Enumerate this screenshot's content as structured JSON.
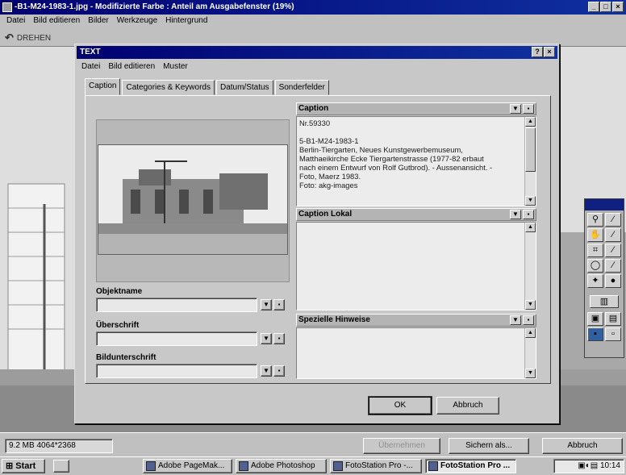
{
  "app": {
    "title": "-B1-M24-1983-1.jpg - Modifizierte Farbe : Anteil am Ausgabefenster (19%)",
    "menu": [
      "Datei",
      "Bild editieren",
      "Bilder",
      "Werkzeuge",
      "Hintergrund"
    ],
    "toolbar_rotate_label": "DREHEN"
  },
  "dialog": {
    "title": "TEXT",
    "menu": [
      "Datei",
      "Bild editieren",
      "Muster"
    ],
    "tabs": [
      "Caption",
      "Categories & Keywords",
      "Datum/Status",
      "Sonderfelder"
    ],
    "active_tab": "Caption",
    "fields": {
      "objektname_label": "Objektname",
      "ueberschrift_label": "Überschrift",
      "bildunterschrift_label": "Bildunterschrift"
    },
    "sections": {
      "caption_label": "Caption",
      "caption_text": "Nr.59330\n\n5-B1-M24-1983-1\nBerlin-Tiergarten, Neues Kunstgewerbemuseum,\nMatthaeikirche Ecke Tiergartenstrasse (1977-82 erbaut\nnach einem Entwurf von Rolf Gutbrod). - Aussenansicht. -\nFoto, Maerz 1983.\nFoto: akg-images",
      "caption_lokal_label": "Caption Lokal",
      "spezielle_hinweise_label": "Spezielle Hinweise"
    },
    "buttons": {
      "ok": "OK",
      "abbruch": "Abbruch"
    }
  },
  "status": {
    "file_info": "9.2 MB  4064*2368",
    "btn_uebernehmen": "Übernehmen",
    "btn_sichern": "Sichern als...",
    "btn_abbruch": "Abbruch"
  },
  "taskbar": {
    "start": "Start",
    "tasks": [
      "Adobe PageMak...",
      "Adobe Photoshop",
      "FotoStation Pro -...",
      "FotoStation Pro ..."
    ],
    "clock": "10:14"
  },
  "icons": {
    "dropdown": "chevron-down-icon",
    "more": "more-icon",
    "scroll_up": "arrow-up-icon",
    "scroll_down": "arrow-down-icon"
  }
}
